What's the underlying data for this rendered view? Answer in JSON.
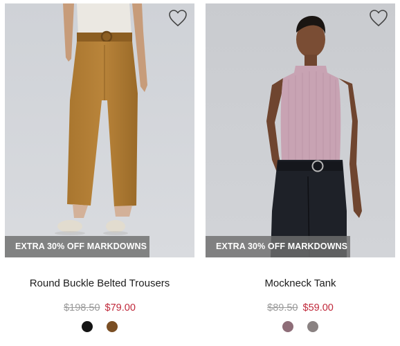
{
  "products": [
    {
      "name": "Round Buckle Belted Trousers",
      "badge": "EXTRA 30% OFF MARKDOWNS",
      "original_price": "$198.50",
      "sale_price": "$79.00",
      "swatches": [
        {
          "color": "#141414"
        },
        {
          "color": "#7a4f24"
        }
      ]
    },
    {
      "name": "Mockneck Tank",
      "badge": "EXTRA 30% OFF MARKDOWNS",
      "original_price": "$89.50",
      "sale_price": "$59.00",
      "swatches": [
        {
          "color": "#8e6d78"
        },
        {
          "color": "#8a8282"
        }
      ]
    }
  ],
  "icons": {
    "wishlist": "heart-outline-icon"
  },
  "colors": {
    "sale": "#c0283a",
    "strike": "#9a9a9a",
    "badge_bg": "#6e6e6e"
  }
}
